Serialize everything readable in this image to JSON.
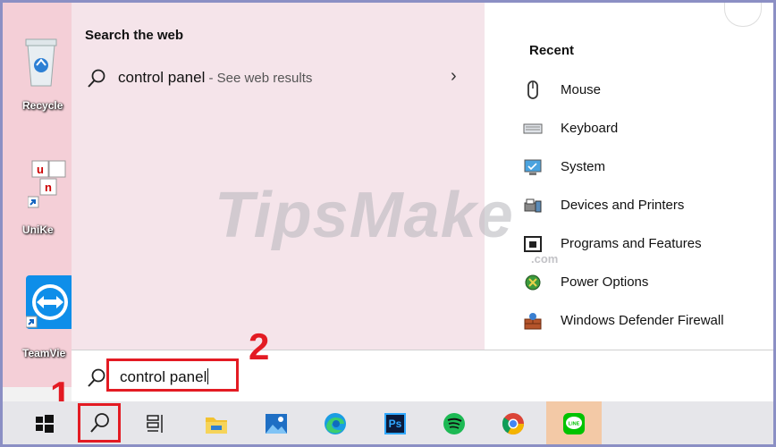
{
  "desktop": {
    "icons": [
      "Recycle",
      "UniKe",
      "TeamVie"
    ]
  },
  "start_menu": {
    "search_web_heading": "Search the web",
    "web_result": {
      "query": "control panel",
      "suffix": " - See web results",
      "chevron": "›"
    },
    "recent_heading": "Recent",
    "recent_items": [
      {
        "label": "Mouse",
        "icon": "mouse-icon"
      },
      {
        "label": "Keyboard",
        "icon": "keyboard-icon"
      },
      {
        "label": "System",
        "icon": "system-icon"
      },
      {
        "label": "Devices and Printers",
        "icon": "printer-icon"
      },
      {
        "label": "Programs and Features",
        "icon": "programs-icon"
      },
      {
        "label": "Power Options",
        "icon": "power-icon"
      },
      {
        "label": "Windows Defender Firewall",
        "icon": "firewall-icon"
      }
    ]
  },
  "search": {
    "value": "control panel"
  },
  "annotations": {
    "step1": "1",
    "step2": "2"
  },
  "watermark": {
    "text": "TipsMake",
    "suffix": ".com"
  },
  "taskbar": {
    "items": [
      "start-button",
      "search-button",
      "task-view-button",
      "file-explorer-button",
      "photos-button",
      "edge-button",
      "photoshop-button",
      "spotify-button",
      "chrome-button",
      "line-button"
    ],
    "photoshop_label": "Ps",
    "line_label": "LINE"
  },
  "colors": {
    "highlight_red": "#e31b23",
    "menu_left_bg": "#f5e4ea",
    "taskbar_bg": "#e6e6ea"
  }
}
